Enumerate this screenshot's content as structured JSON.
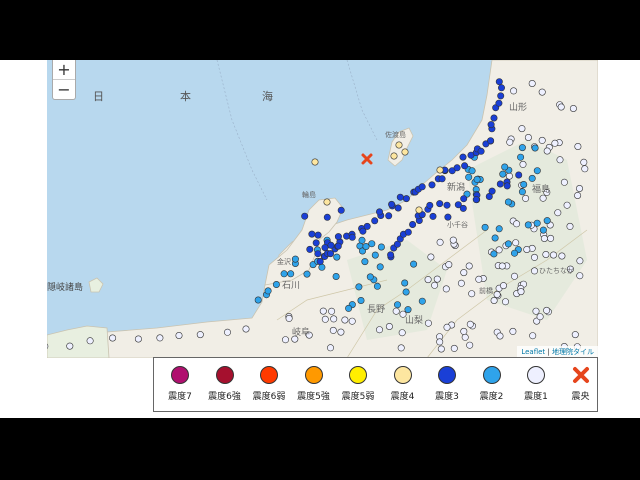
{
  "map": {
    "zoom_in": "+",
    "zoom_out": "−",
    "sea_label": [
      "日",
      "本",
      "海"
    ],
    "islands": [
      "隠岐諸島",
      "佐渡島"
    ],
    "place_labels": [
      "福島",
      "新潟",
      "山形",
      "石川",
      "長野",
      "山梨",
      "岐阜",
      "輪島",
      "金沢",
      "小千谷",
      "ひたちなか",
      "前橋"
    ],
    "attribution": {
      "leaflet": "Leaflet",
      "separator": " | ",
      "source": "地理院タイル"
    },
    "epicenter": {
      "lat": 37.77,
      "lon": 137.9
    }
  },
  "legend": {
    "items": [
      {
        "label": "震度7",
        "color": "#b0106f"
      },
      {
        "label": "震度6強",
        "color": "#a5102e"
      },
      {
        "label": "震度6弱",
        "color": "#ff3a00"
      },
      {
        "label": "震度5強",
        "color": "#ff9900"
      },
      {
        "label": "震度5弱",
        "color": "#ffee00"
      },
      {
        "label": "震度4",
        "color": "#fde6a0"
      },
      {
        "label": "震度3",
        "color": "#1a3fd6"
      },
      {
        "label": "震度2",
        "color": "#2fa3ea"
      },
      {
        "label": "震度1",
        "color": "#eef0ff"
      },
      {
        "label": "震央",
        "color": "#e6451c",
        "icon": "x-icon"
      }
    ]
  }
}
